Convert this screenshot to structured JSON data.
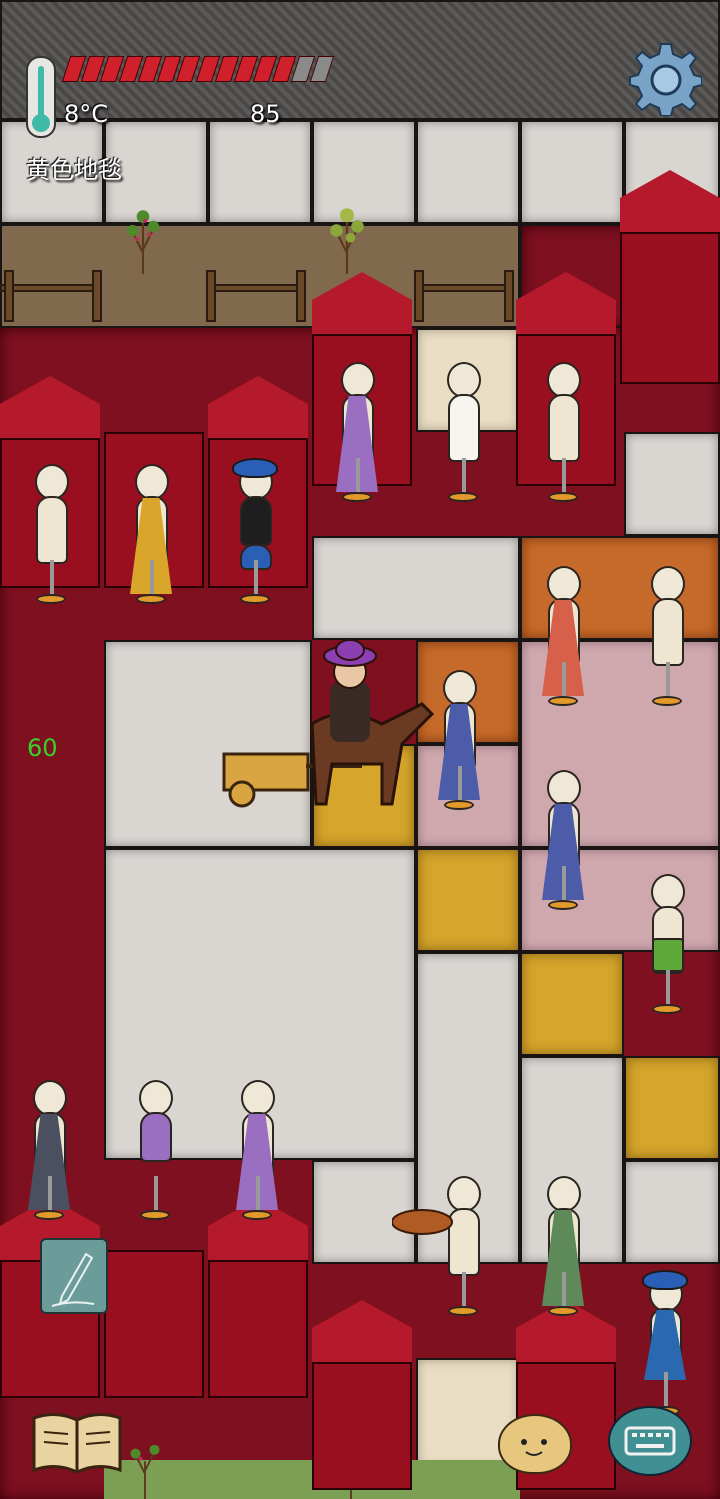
{
  "hud": {
    "temperature": "8°C",
    "hunger_value": "85",
    "hover_label": "黄色地毯",
    "age_value": "60",
    "hp_segments_total": 14,
    "hp_segments_filled": 12,
    "age_color": "#36d12a",
    "accent_red": "#d0202c"
  },
  "icons": {
    "settings": "gear-icon",
    "write": "pencil-icon",
    "tech_book": "open-book-icon",
    "emote": "smiley-face-icon",
    "chat": "keyboard-icon"
  }
}
